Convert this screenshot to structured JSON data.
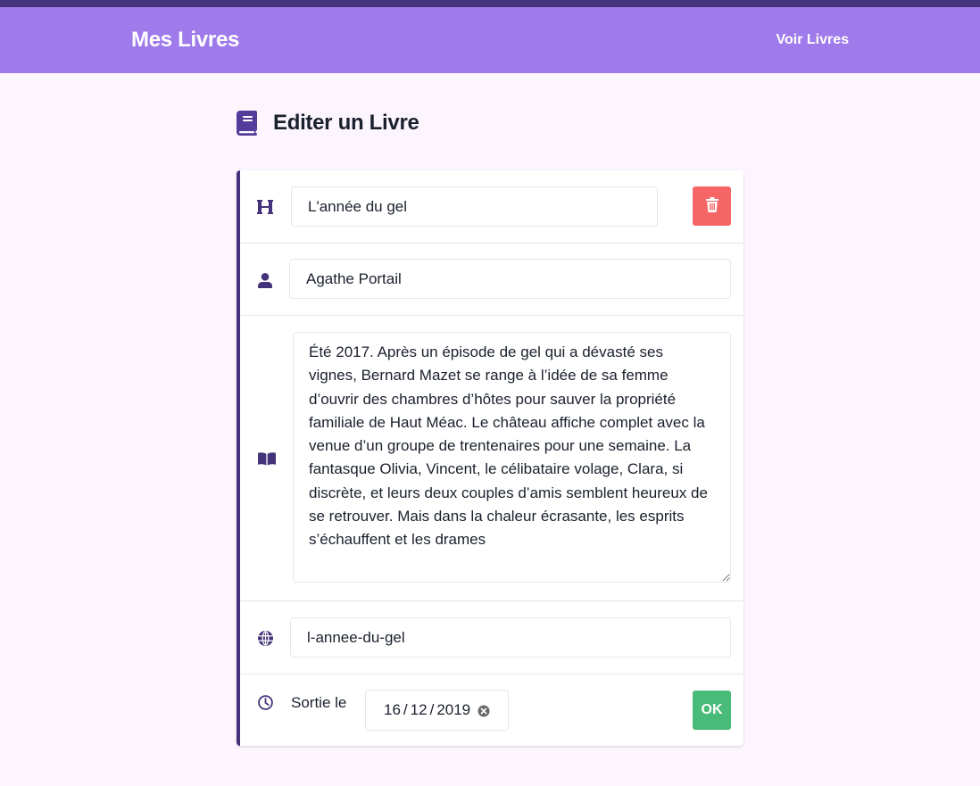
{
  "navbar": {
    "brand": "Mes Livres",
    "link": "Voir Livres"
  },
  "page": {
    "title": "Editer un Livre",
    "title_icon": "book-icon"
  },
  "form": {
    "title_value": "L'année du gel",
    "author_value": "Agathe Portail",
    "summary_value": "Été 2017. Après un épisode de gel qui a dévasté ses vignes, Bernard Mazet se range à l’idée de sa femme d’ouvrir des chambres d’hôtes pour sauver la propriété familiale de Haut Méac. Le château affiche complet avec la venue d’un groupe de trentenaires pour une semaine. La fantasque Olivia, Vincent, le célibataire volage, Clara, si discrète, et leurs deux couples d’amis semblent heureux de se retrouver. Mais dans la chaleur écrasante, les esprits s’échauffent et les drames",
    "slug_value": "l-annee-du-gel",
    "release_label": "Sortie le",
    "release_day": "16",
    "release_month": "12",
    "release_year": "2019",
    "date_separator": "/",
    "ok_label": "OK"
  },
  "icons": {
    "title_field": "heading-icon",
    "author_field": "user-icon",
    "summary_field": "open-book-icon",
    "slug_field": "globe-icon",
    "date_field": "clock-icon",
    "delete": "trash-icon",
    "clear": "clear-icon"
  },
  "colors": {
    "accent": "#9f7aea",
    "accent_dark": "#44337a",
    "danger": "#f56565",
    "success": "#48bb78",
    "background": "#fcf5fe"
  }
}
